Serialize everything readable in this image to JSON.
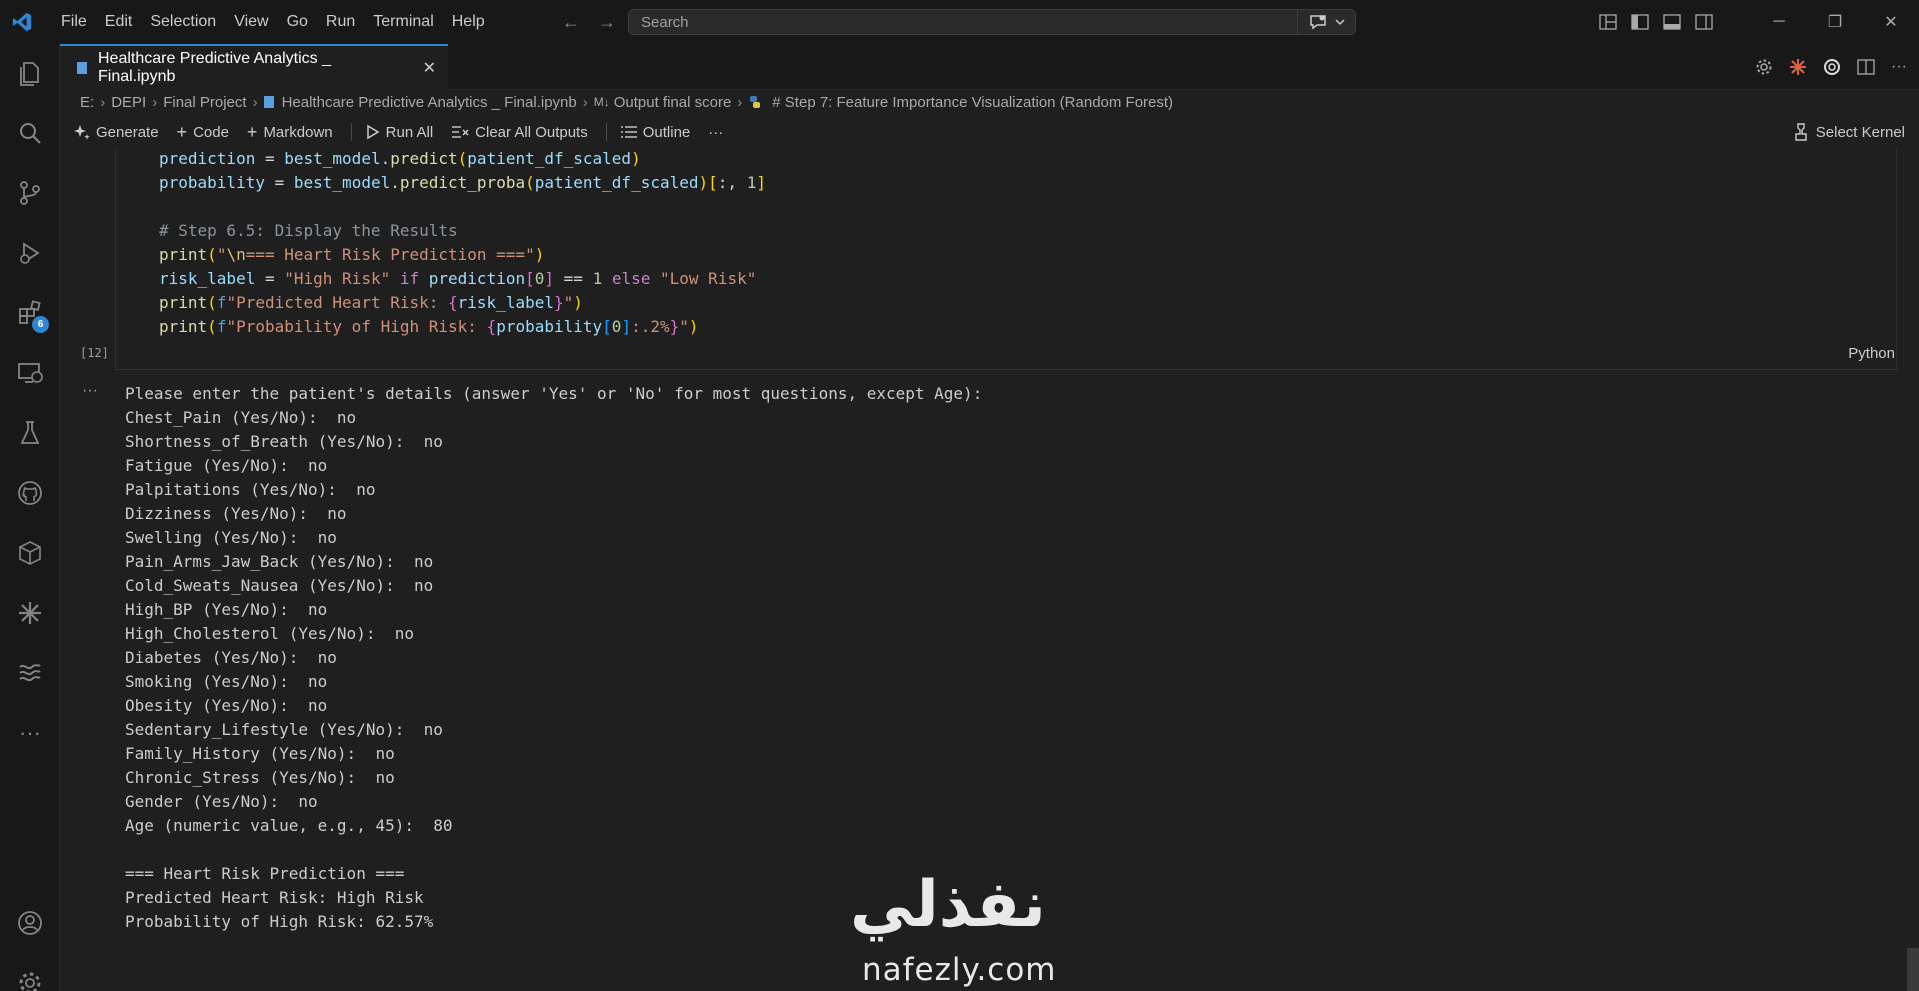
{
  "menu": [
    "File",
    "Edit",
    "Selection",
    "View",
    "Go",
    "Run",
    "Terminal",
    "Help"
  ],
  "search": {
    "placeholder": "Search"
  },
  "activity": {
    "extensions_badge": "6"
  },
  "tab": {
    "label": "Healthcare Predictive Analytics _ Final.ipynb"
  },
  "breadcrumb": [
    "E:",
    "DEPI",
    "Final Project",
    "Healthcare Predictive Analytics _ Final.ipynb",
    "Output final score",
    "# Step 7: Feature Importance Visualization (Random Forest)"
  ],
  "toolbar": {
    "generate": "Generate",
    "code": "Code",
    "markdown": "Markdown",
    "run_all": "Run All",
    "clear_outputs": "Clear All Outputs",
    "outline": "Outline",
    "more": "···",
    "kernel": "Select Kernel"
  },
  "cell": {
    "exec_count": "[12]",
    "language": "Python",
    "code": [
      "prediction = best_model.predict(patient_df_scaled)",
      "probability = best_model.predict_proba(patient_df_scaled)[:, 1]",
      "",
      "# Step 6.5: Display the Results",
      "print(\"\\n=== Heart Risk Prediction ===\")",
      "risk_label = \"High Risk\" if prediction[0] == 1 else \"Low Risk\"",
      "print(f\"Predicted Heart Risk: {risk_label}\")",
      "print(f\"Probability of High Risk: {probability[0]:.2%}\")"
    ]
  },
  "output": {
    "marker": "···",
    "lines": [
      "Please enter the patient's details (answer 'Yes' or 'No' for most questions, except Age):",
      "Chest_Pain (Yes/No):  no",
      "Shortness_of_Breath (Yes/No):  no",
      "Fatigue (Yes/No):  no",
      "Palpitations (Yes/No):  no",
      "Dizziness (Yes/No):  no",
      "Swelling (Yes/No):  no",
      "Pain_Arms_Jaw_Back (Yes/No):  no",
      "Cold_Sweats_Nausea (Yes/No):  no",
      "High_BP (Yes/No):  no",
      "High_Cholesterol (Yes/No):  no",
      "Diabetes (Yes/No):  no",
      "Smoking (Yes/No):  no",
      "Obesity (Yes/No):  no",
      "Sedentary_Lifestyle (Yes/No):  no",
      "Family_History (Yes/No):  no",
      "Chronic_Stress (Yes/No):  no",
      "Gender (Yes/No):  no",
      "Age (numeric value, e.g., 45):  80",
      "",
      "=== Heart Risk Prediction ===",
      "Predicted Heart Risk: High Risk",
      "Probability of High Risk: 62.57%"
    ]
  },
  "watermark": {
    "arabic": "نفذلي",
    "latin": "nafezly.com"
  }
}
